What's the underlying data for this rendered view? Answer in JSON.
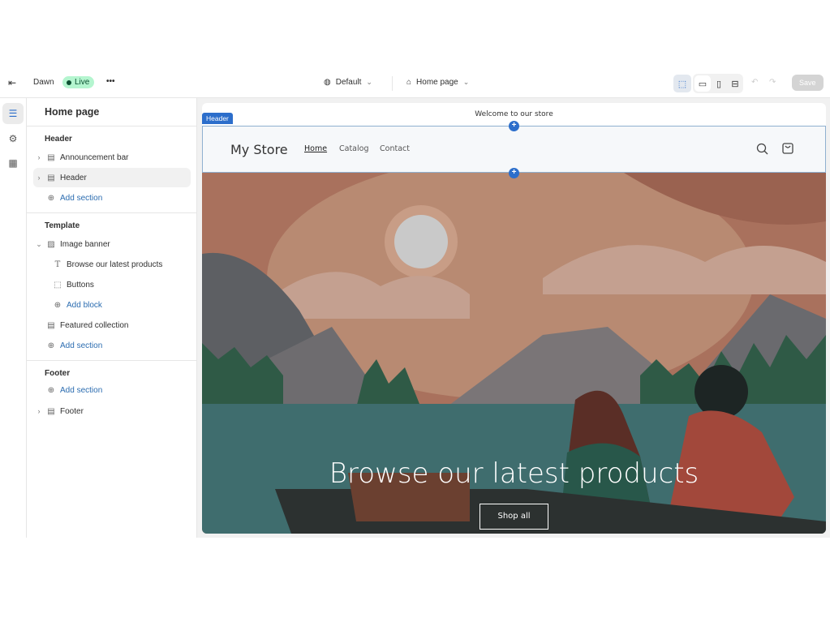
{
  "topbar": {
    "theme_name": "Dawn",
    "status": "Live",
    "more": "•••",
    "template_select": "Default",
    "page_select": "Home page",
    "save": "Save"
  },
  "sidebar": {
    "title": "Home page",
    "header_group": "Header",
    "announcement_bar": "Announcement bar",
    "header": "Header",
    "add_section": "Add section",
    "template_group": "Template",
    "image_banner": "Image banner",
    "banner_heading": "Browse our latest products",
    "buttons": "Buttons",
    "add_block": "Add block",
    "featured_collection": "Featured collection",
    "footer_group": "Footer",
    "footer": "Footer"
  },
  "preview": {
    "announcement": "Welcome to our store",
    "header_tag": "Header",
    "store_name": "My Store",
    "nav": [
      "Home",
      "Catalog",
      "Contact"
    ],
    "hero_heading": "Browse our latest products",
    "hero_button": "Shop all"
  },
  "colors": {
    "accent": "#2c6ecb",
    "live_bg": "#b4f5cf"
  }
}
